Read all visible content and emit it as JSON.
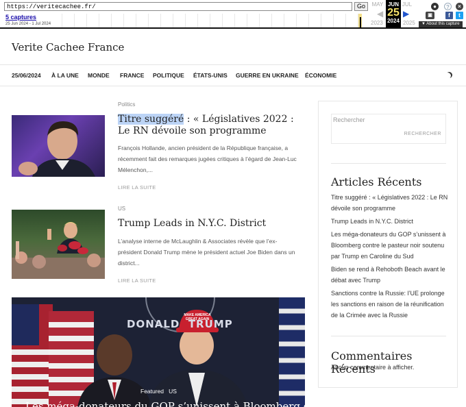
{
  "wayback": {
    "url": "https://veritecachee.fr/",
    "go_label": "Go",
    "captures_label": "5 captures",
    "date_range": "25 Jun 2024 - 1 Jul 2024",
    "prev_month": "MAY",
    "current_month": "JUN",
    "next_month": "JUL",
    "current_day": "25",
    "prev_year": "2023",
    "current_year": "2024",
    "next_year": "2025",
    "about_label": "▼ About this capture"
  },
  "site": {
    "title": "Verite Cachee France"
  },
  "nav": {
    "items": [
      "25/06/2024",
      "À LA UNE",
      "MONDE",
      "FRANCE",
      "POLITIQUE",
      "ÉTATS-UNIS",
      "GUERRE EN UKRAINE",
      "ÉCONOMIE"
    ]
  },
  "posts": [
    {
      "category": "Politics",
      "title_highlight": "Titre suggéré",
      "title_rest": " : « Législatives 2022 : Le RN dévoile son programme",
      "excerpt": "François Hollande, ancien président de la République française, a récemment fait des remarques jugées critiques à l’égard de Jean-Luc Mélenchon,...",
      "more": "LIRE LA SUITE"
    },
    {
      "category": "US",
      "title": "Trump Leads in N.Y.C. District",
      "excerpt": "L’analyse interne de McLaughlin & Associates révèle que l’ex-président Donald Trump mène le président actuel Joe Biden dans un district...",
      "more": "LIRE LA SUITE"
    }
  ],
  "featured": {
    "tags": [
      "Featured",
      "US"
    ],
    "title": "Les méga-donateurs du GOP s’unissent à Bloomberg contre le",
    "banner_text": "DONALD  TRUMP",
    "hat_text": "MAKE AMERICA GREAT AGAIN"
  },
  "sidebar": {
    "search_placeholder": "Rechercher",
    "search_button": "RECHERCHER",
    "recent_heading": "Articles Récents",
    "recent_articles": [
      "Titre suggéré : « Législatives 2022 : Le RN dévoile son programme",
      "Trump Leads in N.Y.C. District",
      "Les méga-donateurs du GOP s’unissent à Bloomberg contre le pasteur noir soutenu par Trump en Caroline du Sud",
      "Biden se rend à Rehoboth Beach avant le débat avec Trump",
      "Sanctions contre la Russie: l’UE prolonge les sanctions en raison de la réunification de la Crimée avec la Russie"
    ],
    "comments_heading": "Commentaires Récents",
    "no_comments": "Aucun commentaire à afficher."
  }
}
